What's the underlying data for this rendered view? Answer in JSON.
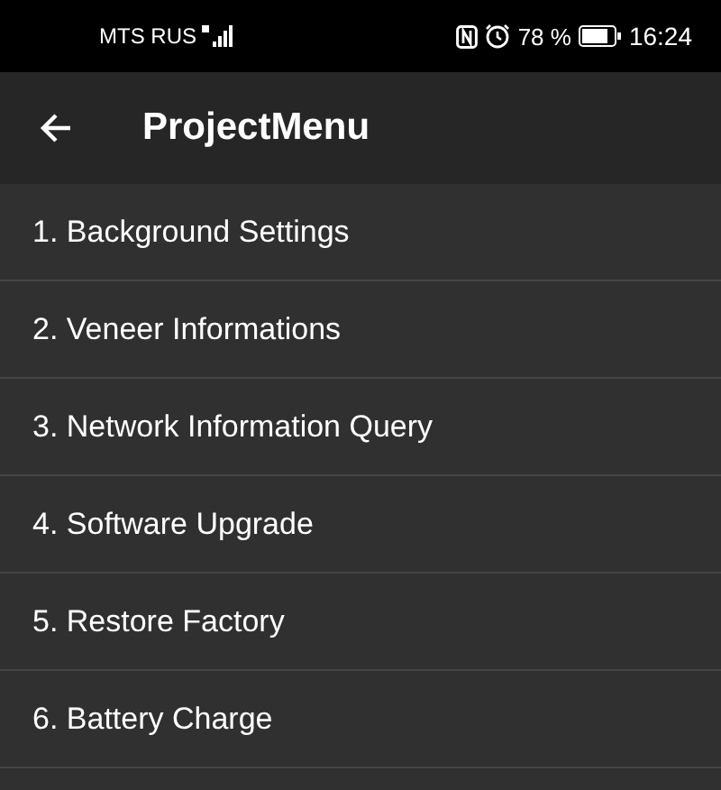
{
  "status_bar": {
    "carrier": "MTS RUS",
    "battery": "78 %",
    "time": "16:24"
  },
  "toolbar": {
    "title": "ProjectMenu"
  },
  "menu": {
    "items": [
      {
        "label": "1. Background Settings"
      },
      {
        "label": "2. Veneer Informations"
      },
      {
        "label": "3. Network Information Query"
      },
      {
        "label": "4. Software Upgrade"
      },
      {
        "label": "5. Restore Factory"
      },
      {
        "label": "6. Battery Charge"
      }
    ]
  }
}
